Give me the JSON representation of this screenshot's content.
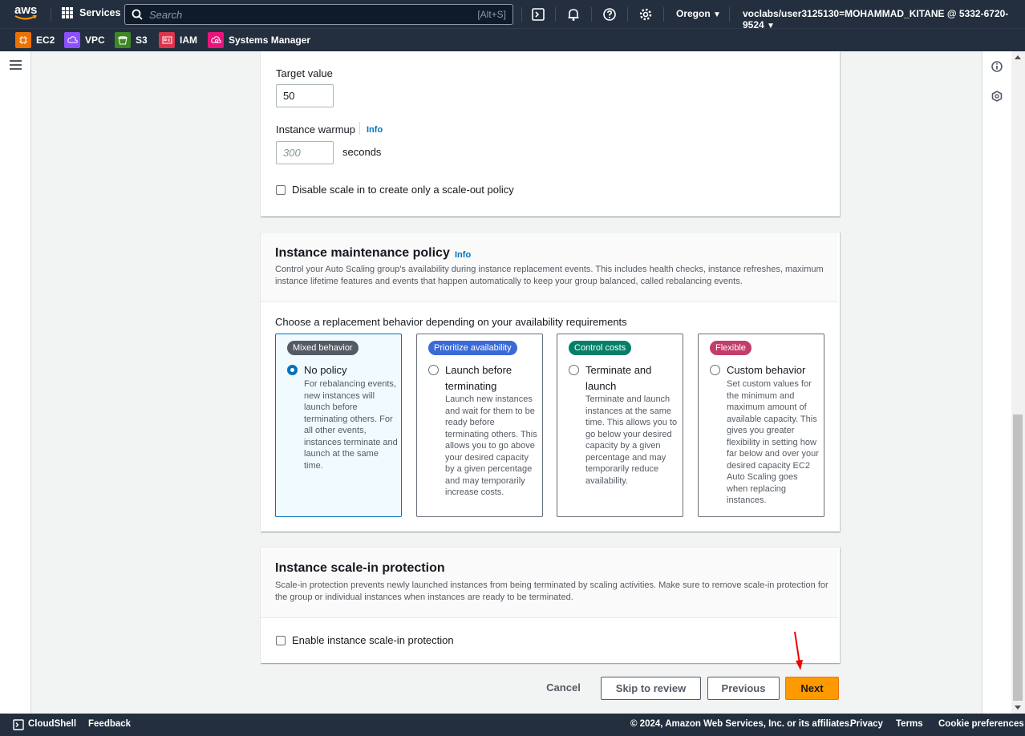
{
  "topnav": {
    "logo": "aws",
    "services": "Services",
    "search_placeholder": "Search",
    "search_shortcut": "[Alt+S]",
    "region": "Oregon",
    "account": "voclabs/user3125130=MOHAMMAD_KITANE @ 5332-6720-9524"
  },
  "favorites": [
    {
      "label": "EC2",
      "color": "#ed7100"
    },
    {
      "label": "VPC",
      "color": "#8c4fff"
    },
    {
      "label": "S3",
      "color": "#3f8624"
    },
    {
      "label": "IAM",
      "color": "#dd344c"
    },
    {
      "label": "Systems Manager",
      "color": "#e7157b"
    }
  ],
  "scaling": {
    "target_label": "Target value",
    "target_value": "50",
    "warmup_label": "Instance warmup",
    "info": "Info",
    "warmup_placeholder": "300",
    "warmup_unit": "seconds",
    "disable_scale_in": "Disable scale in to create only a scale-out policy"
  },
  "maintenance": {
    "title": "Instance maintenance policy",
    "info": "Info",
    "desc": "Control your Auto Scaling group's availability during instance replacement events. This includes health checks, instance refreshes, maximum instance lifetime features and events that happen automatically to keep your group balanced, called rebalancing events.",
    "prompt": "Choose a replacement behavior depending on your availability requirements",
    "options": [
      {
        "badge": "Mixed behavior",
        "badge_color": "#545b64",
        "title": "No policy",
        "desc": "For rebalancing events, new instances will launch before terminating others. For all other events, instances terminate and launch at the same time.",
        "selected": true
      },
      {
        "badge": "Prioritize availability",
        "badge_color": "#3b6ad6",
        "title": "Launch before terminating",
        "desc": "Launch new instances and wait for them to be ready before terminating others. This allows you to go above your desired capacity by a given percentage and may temporarily increase costs.",
        "selected": false
      },
      {
        "badge": "Control costs",
        "badge_color": "#067f68",
        "title": "Terminate and launch",
        "desc": "Terminate and launch instances at the same time. This allows you to go below your desired capacity by a given percentage and may temporarily reduce availability.",
        "selected": false
      },
      {
        "badge": "Flexible",
        "badge_color": "#c33d69",
        "title": "Custom behavior",
        "desc": "Set custom values for the minimum and maximum amount of available capacity. This gives you greater flexibility in setting how far below and over your desired capacity EC2 Auto Scaling goes when replacing instances.",
        "selected": false
      }
    ]
  },
  "protection": {
    "title": "Instance scale-in protection",
    "desc": "Scale-in protection prevents newly launched instances from being terminated by scaling activities. Make sure to remove scale-in protection for the group or individual instances when instances are ready to be terminated.",
    "checkbox": "Enable instance scale-in protection"
  },
  "actions": {
    "cancel": "Cancel",
    "skip": "Skip to review",
    "previous": "Previous",
    "next": "Next"
  },
  "footer": {
    "cloudshell": "CloudShell",
    "feedback": "Feedback",
    "copyright": "© 2024, Amazon Web Services, Inc. or its affiliates.",
    "privacy": "Privacy",
    "terms": "Terms",
    "cookies": "Cookie preferences"
  }
}
